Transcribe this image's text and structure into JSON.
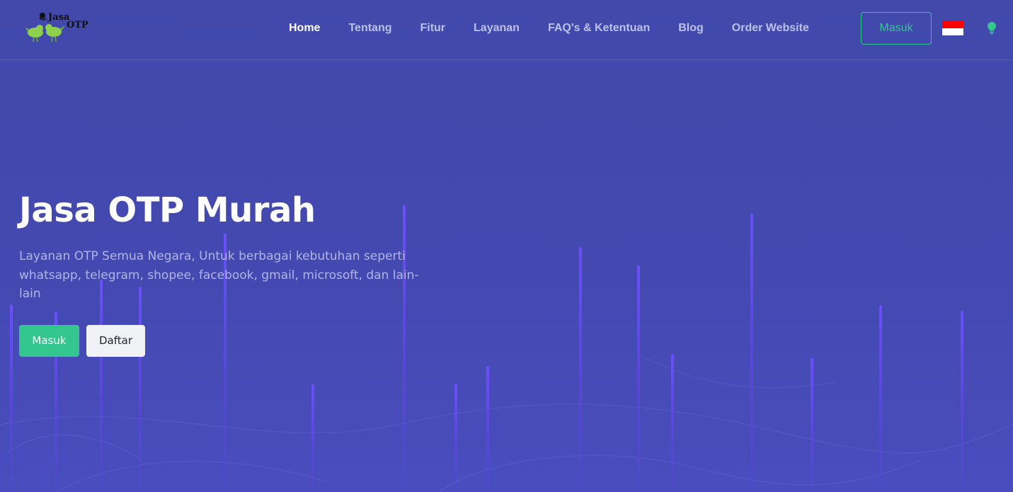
{
  "brand": {
    "logo_line1": "Jasa",
    "logo_line2": "OTP",
    "logo_icon": "birds-logo-icon"
  },
  "nav": {
    "items": [
      {
        "label": "Home",
        "active": true
      },
      {
        "label": "Tentang",
        "active": false
      },
      {
        "label": "Fitur",
        "active": false
      },
      {
        "label": "Layanan",
        "active": false
      },
      {
        "label": "FAQ's & Ketentuan",
        "active": false
      },
      {
        "label": "Blog",
        "active": false
      },
      {
        "label": "Order Website",
        "active": false
      }
    ],
    "login_label": "Masuk",
    "language_icon": "indonesia-flag-icon",
    "theme_icon": "lightbulb-icon"
  },
  "hero": {
    "title": "Jasa OTP Murah",
    "description": "Layanan OTP Semua Negara, Untuk berbagai kebutuhan seperti whatsapp, telegram, shopee, facebook, gmail, microsoft, dan lain-lain",
    "primary_button": "Masuk",
    "secondary_button": "Daftar"
  },
  "colors": {
    "background": "#4249ab",
    "accent_green": "#33c78f",
    "light_button": "#f1f2f6",
    "flag_red": "#ff0000",
    "flag_white": "#ffffff"
  }
}
